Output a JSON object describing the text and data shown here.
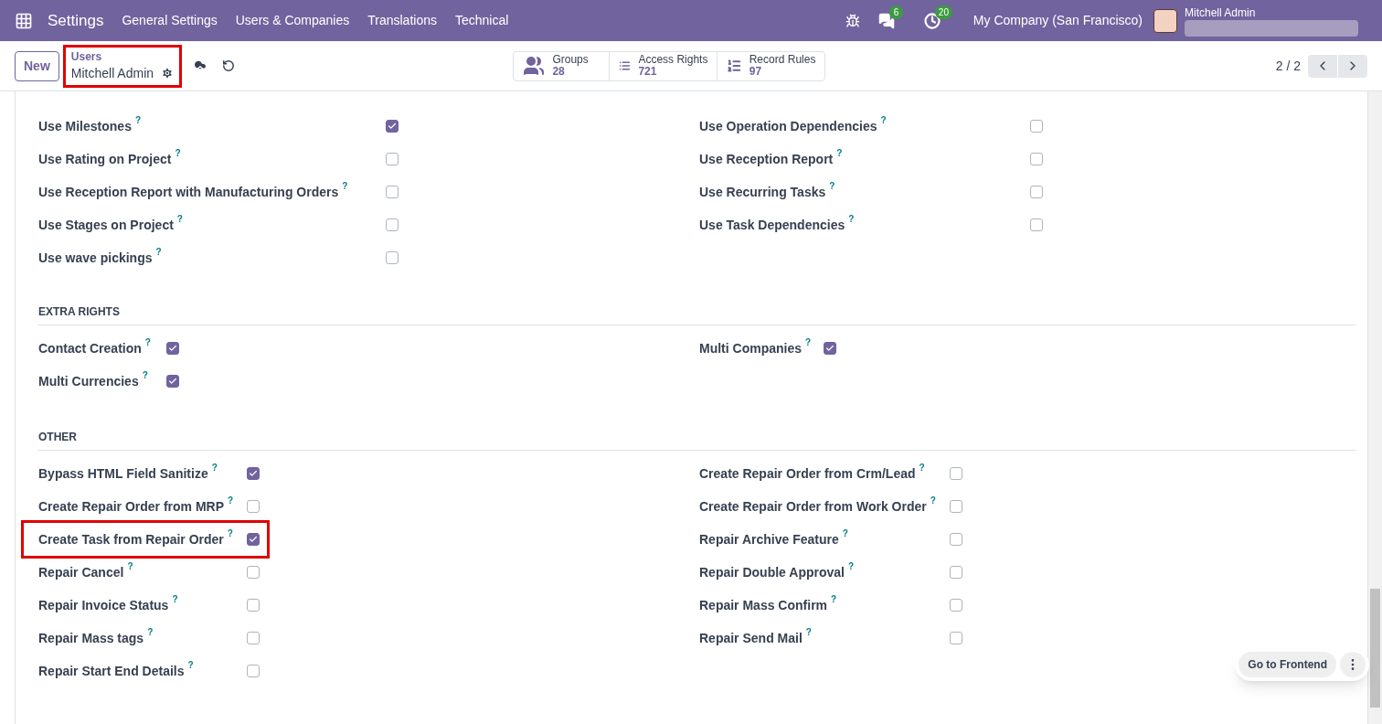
{
  "navbar": {
    "app": "Settings",
    "menus": [
      "General Settings",
      "Users & Companies",
      "Translations",
      "Technical"
    ],
    "messages_badge": "6",
    "activity_badge": "20",
    "company": "My Company (San Francisco)",
    "user": "Mitchell Admin"
  },
  "control_panel": {
    "new_button": "New",
    "breadcrumb": {
      "parent": "Users",
      "current": "Mitchell Admin",
      "highlighted": true
    },
    "stats": [
      {
        "kind": "groups",
        "label": "Groups",
        "count": "28"
      },
      {
        "kind": "list",
        "label": "Access Rights",
        "count": "721"
      },
      {
        "kind": "bullets",
        "label": "Record Rules",
        "count": "97"
      }
    ],
    "pager": "2 / 2"
  },
  "sections": [
    {
      "left": [
        {
          "label": "Use Milestones",
          "help": "?",
          "checked": true,
          "highlighted": false
        },
        {
          "label": "Use Rating on Project",
          "help": "?",
          "checked": false,
          "highlighted": false
        },
        {
          "label": "Use Reception Report with Manufacturing Orders",
          "help": "?",
          "checked": false,
          "highlighted": false
        },
        {
          "label": "Use Stages on Project",
          "help": "?",
          "checked": false,
          "highlighted": false
        },
        {
          "label": "Use wave pickings",
          "help": "?",
          "checked": false,
          "highlighted": false
        }
      ],
      "right": [
        {
          "label": "Use Operation Dependencies",
          "help": "?",
          "checked": false,
          "highlighted": false
        },
        {
          "label": "Use Reception Report",
          "help": "?",
          "checked": false,
          "highlighted": false
        },
        {
          "label": "Use Recurring Tasks",
          "help": "?",
          "checked": false,
          "highlighted": false
        },
        {
          "label": "Use Task Dependencies",
          "help": "?",
          "checked": false,
          "highlighted": false
        }
      ]
    },
    {
      "title": "EXTRA RIGHTS",
      "left": [
        {
          "label": "Contact Creation",
          "help": "?",
          "checked": true,
          "highlighted": false
        },
        {
          "label": "Multi Currencies",
          "help": "?",
          "checked": true,
          "highlighted": false
        }
      ],
      "right": [
        {
          "label": "Multi Companies",
          "help": "?",
          "checked": true,
          "highlighted": false
        }
      ]
    },
    {
      "title": "OTHER",
      "left": [
        {
          "label": "Bypass HTML Field Sanitize",
          "help": "?",
          "checked": true,
          "highlighted": false
        },
        {
          "label": "Create Repair Order from MRP",
          "help": "?",
          "checked": false,
          "highlighted": false
        },
        {
          "label": "Create Task from Repair Order",
          "help": "?",
          "checked": true,
          "highlighted": true
        },
        {
          "label": "Repair Cancel",
          "help": "?",
          "checked": false,
          "highlighted": false
        },
        {
          "label": "Repair Invoice Status",
          "help": "?",
          "checked": false,
          "highlighted": false
        },
        {
          "label": "Repair Mass tags",
          "help": "?",
          "checked": false,
          "highlighted": false
        },
        {
          "label": "Repair Start End Details",
          "help": "?",
          "checked": false,
          "highlighted": false
        }
      ],
      "right": [
        {
          "label": "Create Repair Order from Crm/Lead",
          "help": "?",
          "checked": false,
          "highlighted": false
        },
        {
          "label": "Create Repair Order from Work Order",
          "help": "?",
          "checked": false,
          "highlighted": false
        },
        {
          "label": "Repair Archive Feature",
          "help": "?",
          "checked": false,
          "highlighted": false
        },
        {
          "label": "Repair Double Approval",
          "help": "?",
          "checked": false,
          "highlighted": false
        },
        {
          "label": "Repair Mass Confirm",
          "help": "?",
          "checked": false,
          "highlighted": false
        },
        {
          "label": "Repair Send Mail",
          "help": "?",
          "checked": false,
          "highlighted": false
        }
      ]
    }
  ],
  "floating": {
    "button": "Go to Frontend"
  }
}
